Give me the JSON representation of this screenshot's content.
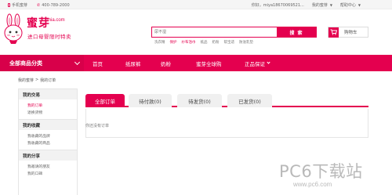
{
  "topbar": {
    "mobile": "手机蜜芽",
    "hotline": "400-789-2000",
    "greeting": "你好，miya18670069521...",
    "my_miya": "我的蜜芽",
    "help": "帮助中心"
  },
  "brand": {
    "name_cn": "蜜芽",
    "name_en": "mia.com",
    "slogan": "进口母婴限时特卖",
    "accent_color": "#e4004f"
  },
  "search": {
    "placeholder": "尿不湿",
    "button": "搜 索",
    "hot_words": [
      "洗衣精",
      "保护",
      "纱布浴巾",
      "纸品",
      "奶粉",
      "帮宝适",
      "防溢乳垫"
    ],
    "highlighted": [
      1,
      2
    ]
  },
  "cart": {
    "label": "购物车",
    "icon": "cart-icon"
  },
  "nav": {
    "category": "全部商品分类",
    "items": [
      "首页",
      "纸尿裤",
      "奶粉",
      "蜜芽全球购",
      "正品保证"
    ]
  },
  "breadcrumb": [
    "我的蜜芽",
    ">",
    "我的订单"
  ],
  "sidebar": {
    "groups": [
      {
        "title": "我的交易",
        "links": [
          {
            "label": "我的订单",
            "active": true
          },
          {
            "label": "退换货物",
            "active": false
          }
        ]
      },
      {
        "title": "我的收藏",
        "links": [
          {
            "label": "我收藏的品牌",
            "active": false
          },
          {
            "label": "我收藏的商品",
            "active": false
          }
        ]
      },
      {
        "title": "我的分享",
        "links": [
          {
            "label": "我邀请的朋友",
            "active": false
          },
          {
            "label": "我的口碑",
            "active": false
          }
        ]
      }
    ]
  },
  "tabs": [
    "全部订单",
    "待付款(0)",
    "待发货(0)",
    "已发货(0)"
  ],
  "active_tab": 0,
  "empty_text": "你还没有订单",
  "watermark": {
    "main": "PC6下载站",
    "url": "www.pc6.com"
  }
}
